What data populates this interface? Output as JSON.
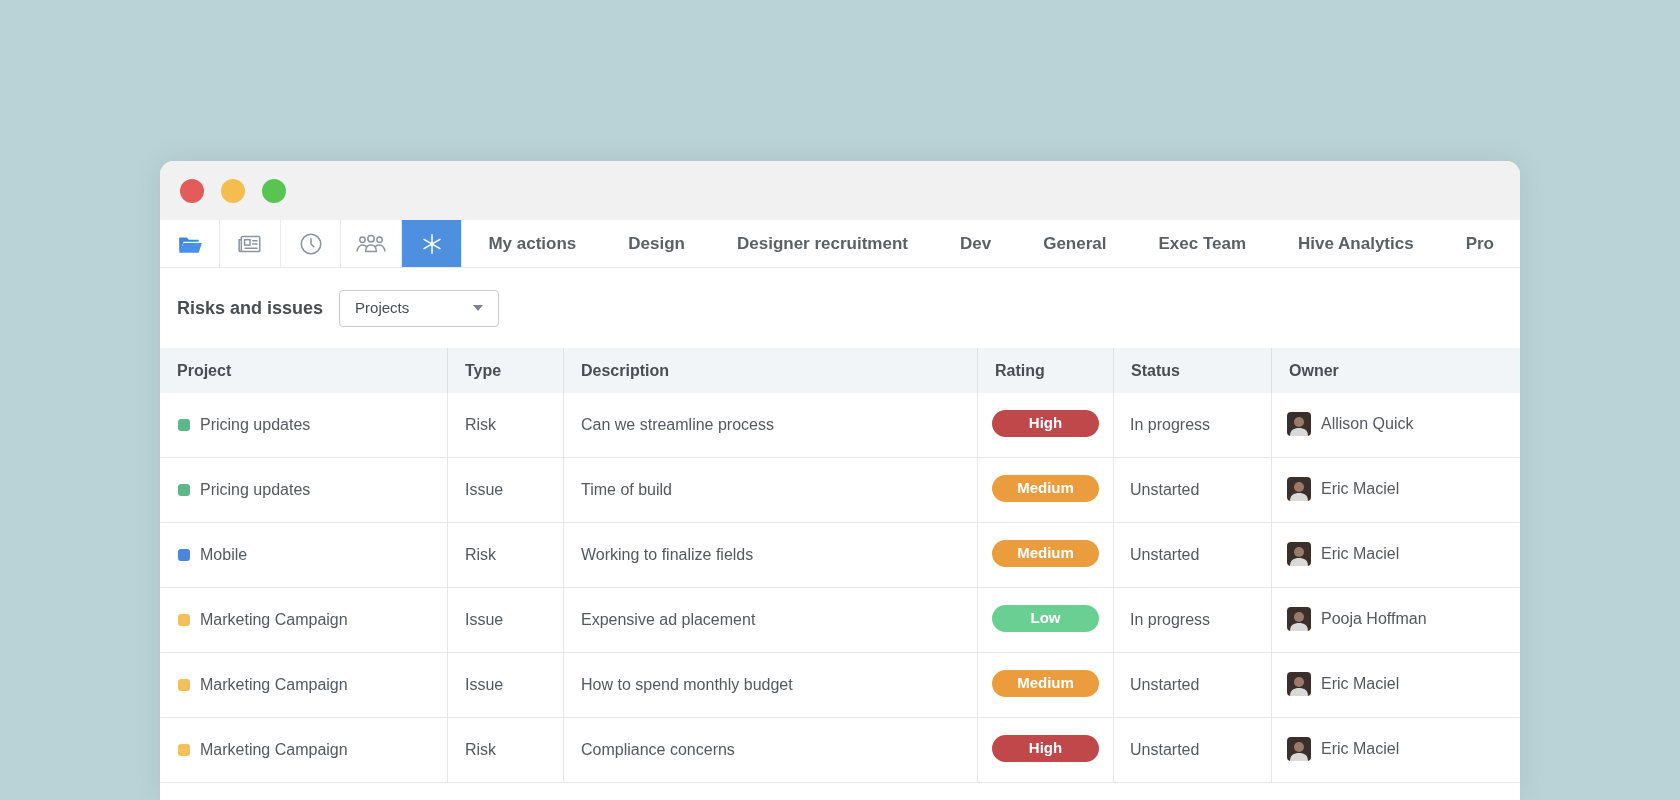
{
  "icon_tabs": [
    {
      "kind": "folder",
      "selected": false
    },
    {
      "kind": "newspaper",
      "selected": false
    },
    {
      "kind": "clock",
      "selected": false
    },
    {
      "kind": "users",
      "selected": false
    },
    {
      "kind": "asterisk",
      "selected": true
    }
  ],
  "tabs": [
    {
      "label": "My actions",
      "selected": false
    },
    {
      "label": "Design",
      "selected": false
    },
    {
      "label": "Designer recruitment",
      "selected": false
    },
    {
      "label": "Dev",
      "selected": false
    },
    {
      "label": "General",
      "selected": false
    },
    {
      "label": "Exec Team",
      "selected": false
    },
    {
      "label": "Hive Analytics",
      "selected": false
    },
    {
      "label": "Pro",
      "selected": false
    }
  ],
  "toolbar": {
    "title": "Risks and issues",
    "dropdown": {
      "value": "Projects"
    }
  },
  "table": {
    "columns": [
      "Project",
      "Type",
      "Description",
      "Rating",
      "Status",
      "Owner"
    ],
    "rows": [
      {
        "project": {
          "name": "Pricing updates",
          "color": "#5cb88a"
        },
        "type": "Risk",
        "description": "Can we streamline process",
        "rating": {
          "label": "High",
          "color": "#c0474a"
        },
        "status": "In progress",
        "owner": "Allison Quick"
      },
      {
        "project": {
          "name": "Pricing updates",
          "color": "#5cb88a"
        },
        "type": "Issue",
        "description": "Time of build",
        "rating": {
          "label": "Medium",
          "color": "#eb9d3e"
        },
        "status": "Unstarted",
        "owner": "Eric Maciel"
      },
      {
        "project": {
          "name": "Mobile",
          "color": "#4a86e0"
        },
        "type": "Risk",
        "description": "Working to finalize fields",
        "rating": {
          "label": "Medium",
          "color": "#eb9d3e"
        },
        "status": "Unstarted",
        "owner": "Eric Maciel"
      },
      {
        "project": {
          "name": "Marketing Campaign",
          "color": "#f3c05a"
        },
        "type": "Issue",
        "description": "Expensive ad placement",
        "rating": {
          "label": "Low",
          "color": "#6acf93"
        },
        "status": "In progress",
        "owner": "Pooja Hoffman"
      },
      {
        "project": {
          "name": "Marketing Campaign",
          "color": "#f3c05a"
        },
        "type": "Issue",
        "description": "How to spend monthly budget",
        "rating": {
          "label": "Medium",
          "color": "#eb9d3e"
        },
        "status": "Unstarted",
        "owner": "Eric Maciel"
      },
      {
        "project": {
          "name": "Marketing Campaign",
          "color": "#f3c05a"
        },
        "type": "Risk",
        "description": "Compliance concerns",
        "rating": {
          "label": "High",
          "color": "#c0474a"
        },
        "status": "Unstarted",
        "owner": "Eric Maciel"
      }
    ]
  }
}
